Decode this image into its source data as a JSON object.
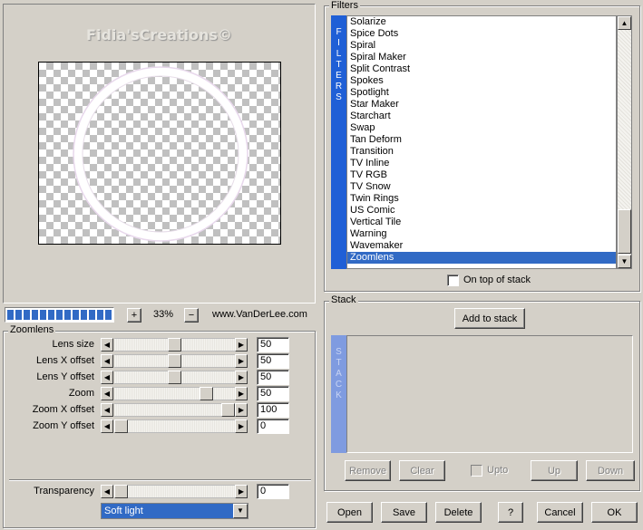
{
  "preview": {
    "watermark": "Fidia'sCreations©"
  },
  "zoom": {
    "progress_segments": 13,
    "plus_label": "+",
    "level": "33%",
    "minus_label": "−",
    "website": "www.VanDerLee.com"
  },
  "zoomlens_group": {
    "title": "Zoomlens",
    "params": [
      {
        "label": "Lens size",
        "value": "50",
        "fraction": 0.5
      },
      {
        "label": "Lens X offset",
        "value": "50",
        "fraction": 0.5
      },
      {
        "label": "Lens Y offset",
        "value": "50",
        "fraction": 0.5
      },
      {
        "label": "Zoom",
        "value": "50",
        "fraction": 0.8
      },
      {
        "label": "Zoom X offset",
        "value": "100",
        "fraction": 1.0
      },
      {
        "label": "Zoom Y offset",
        "value": "0",
        "fraction": 0.0
      }
    ],
    "transparency": {
      "label": "Transparency",
      "value": "0",
      "fraction": 0.0
    },
    "blend_mode": "Soft light"
  },
  "filters_group": {
    "title": "Filters",
    "side_label": "FILTERS",
    "items": [
      "Solarize",
      "Spice Dots",
      "Spiral",
      "Spiral Maker",
      "Split Contrast",
      "Spokes",
      "Spotlight",
      "Star Maker",
      "Starchart",
      "Swap",
      "Tan Deform",
      "Transition",
      "TV Inline",
      "TV RGB",
      "TV Snow",
      "Twin Rings",
      "US Comic",
      "Vertical Tile",
      "Warning",
      "Wavemaker",
      "Zoomlens"
    ],
    "selected": "Zoomlens",
    "on_top_label": "On top of stack"
  },
  "stack_group": {
    "title": "Stack",
    "side_label": "STACK",
    "add_label": "Add to stack",
    "remove_label": "Remove",
    "clear_label": "Clear",
    "upto_label": "Upto",
    "up_label": "Up",
    "down_label": "Down"
  },
  "footer": {
    "open_label": "Open",
    "save_label": "Save",
    "delete_label": "Delete",
    "help_label": "?",
    "cancel_label": "Cancel",
    "ok_label": "OK"
  }
}
